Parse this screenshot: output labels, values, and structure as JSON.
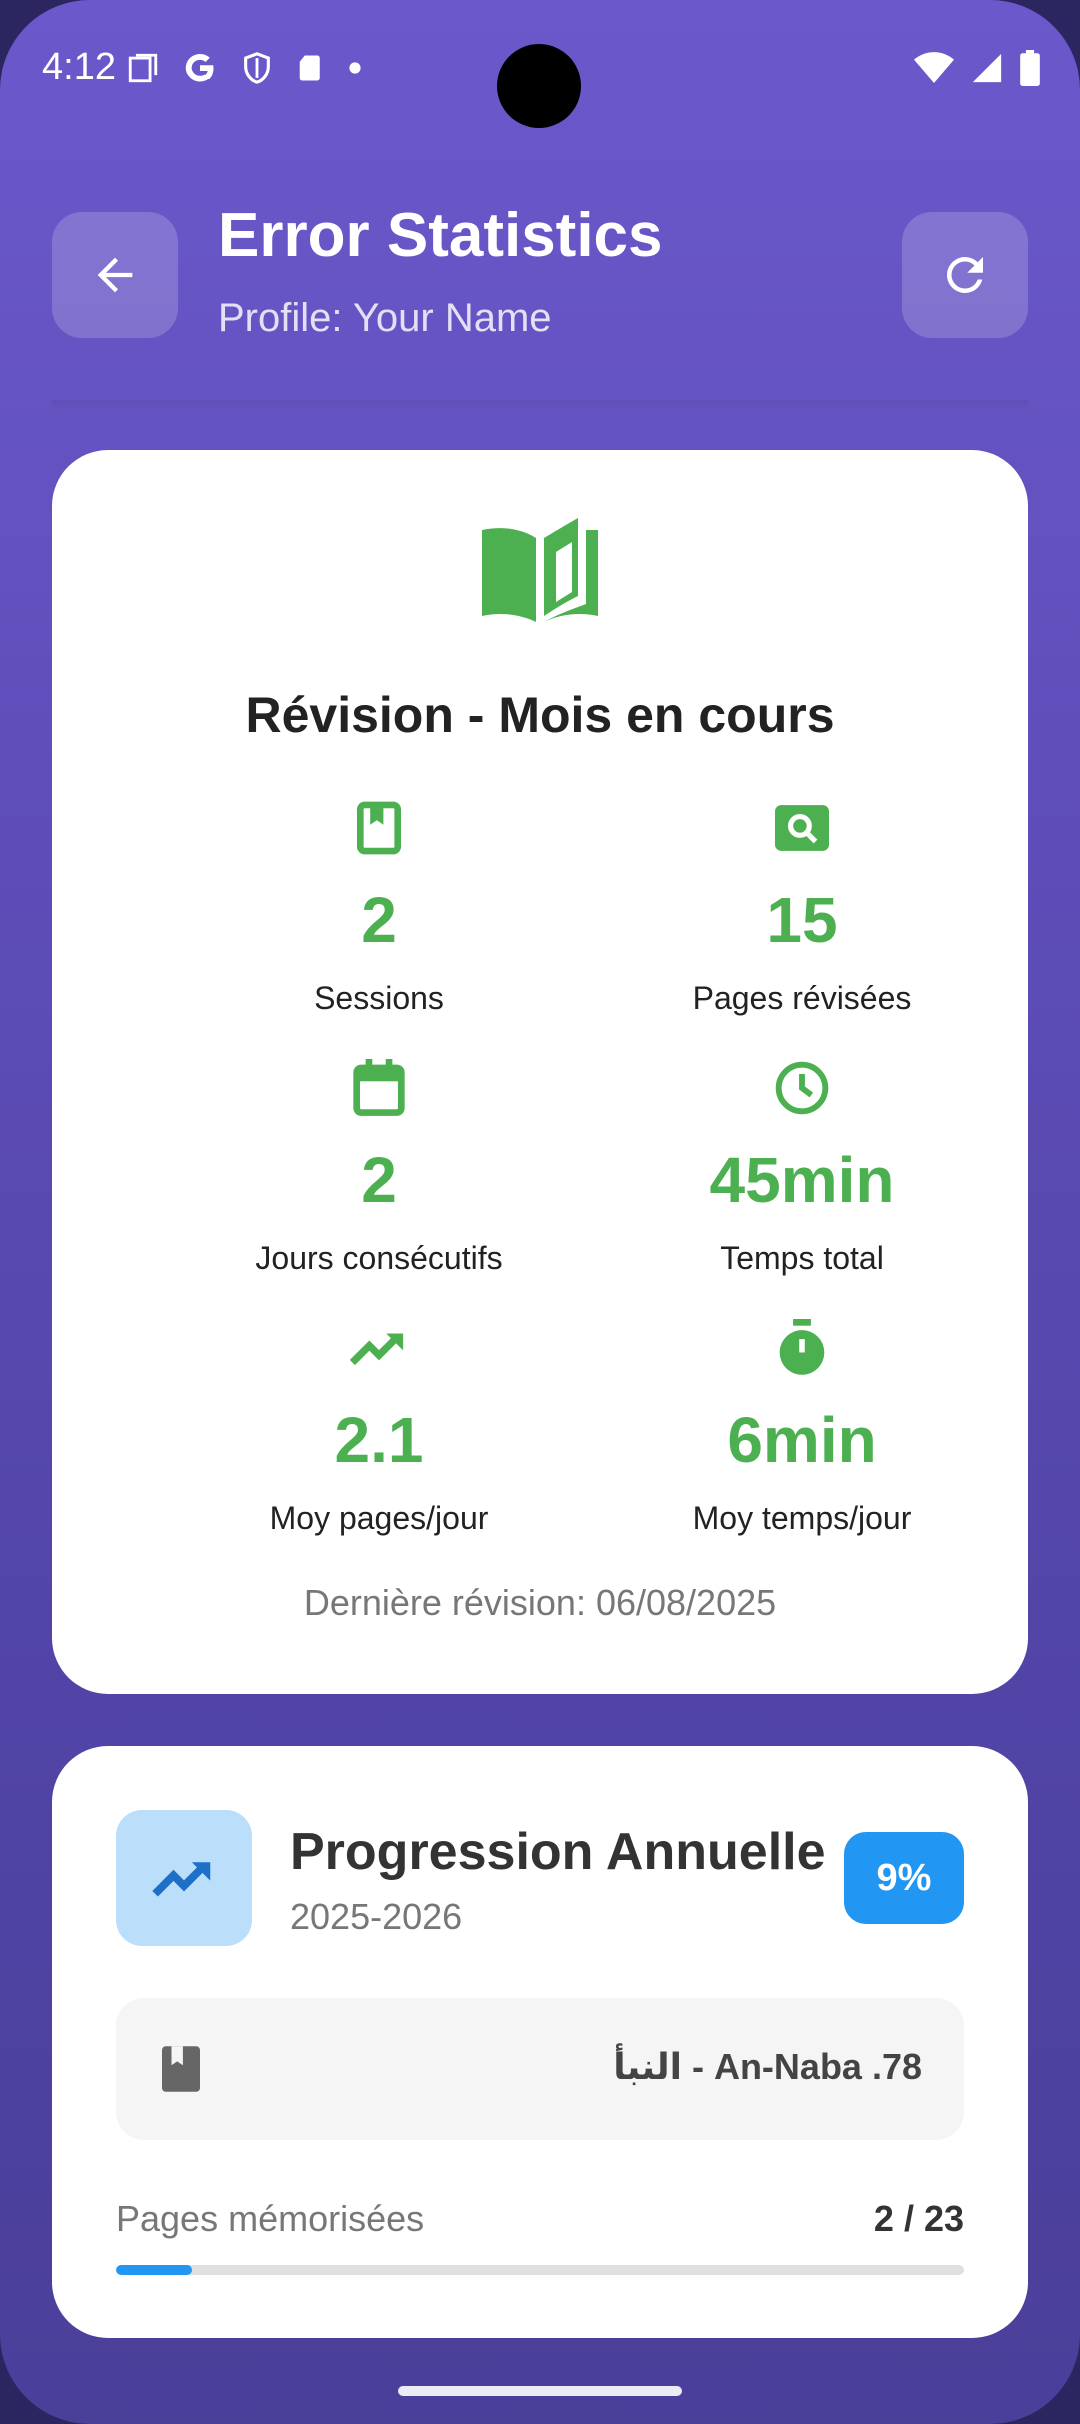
{
  "status_bar": {
    "time": "4:12"
  },
  "header": {
    "title": "Error Statistics",
    "subtitle": "Profile: Your Name"
  },
  "revision_card": {
    "title": "Révision - Mois en cours",
    "stats": [
      {
        "value": "2",
        "label": "Sessions",
        "icon": "bookmark-book-icon"
      },
      {
        "value": "15",
        "label": "Pages révisées",
        "icon": "search-icon"
      },
      {
        "value": "2",
        "label": "Jours consécutifs",
        "icon": "calendar-icon"
      },
      {
        "value": "45min",
        "label": "Temps total",
        "icon": "clock-icon"
      },
      {
        "value": "2.1",
        "label": "Moy pages/jour",
        "icon": "trending-up-icon"
      },
      {
        "value": "6min",
        "label": "Moy temps/jour",
        "icon": "timer-icon"
      }
    ],
    "last_revision": "Dernière révision: 06/08/2025"
  },
  "progression_card": {
    "title": "Progression Annuelle",
    "year": "2025-2026",
    "percent_label": "9%",
    "surah": "النبأ - An-Naba .78",
    "pages_label": "Pages mémorisées",
    "pages_count": "2 / 23",
    "progress_fraction": 0.09
  },
  "colors": {
    "accent_green": "#4caf50",
    "accent_blue": "#2196f3",
    "header_purple": "#6b59cc"
  }
}
